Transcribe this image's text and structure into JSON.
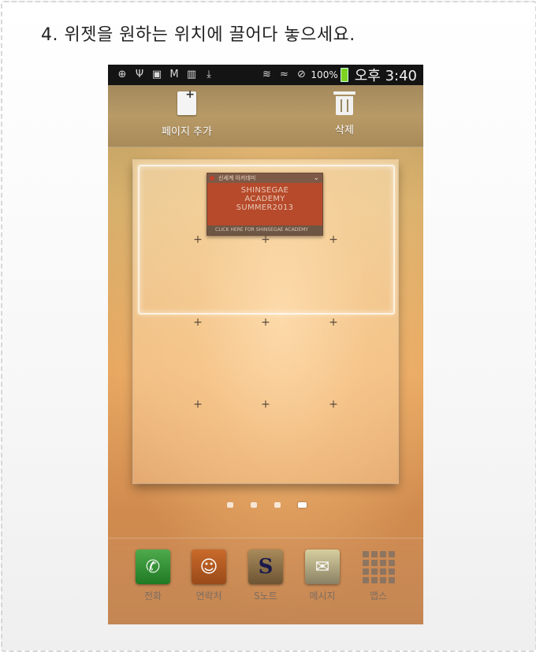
{
  "instruction": "4. 위젯을 원하는 위치에 끌어다 놓으세요.",
  "status_bar": {
    "battery_percent": "100%",
    "time": "오후 3:40"
  },
  "edit_bar": {
    "add_page_label": "페이지 추가",
    "delete_label": "삭제"
  },
  "widget": {
    "header_text": "신세계 아카데미",
    "lines": [
      "SHINSEGAE",
      "ACADEMY",
      "SUMMER2013"
    ],
    "footer_text": "CLICK HERE FOR SHINSEGAE ACADEMY"
  },
  "page_indicator": {
    "count": 4,
    "active_index": 3
  },
  "dock": {
    "apps": [
      {
        "label": "전화"
      },
      {
        "label": "연락처"
      },
      {
        "label": "S노트"
      },
      {
        "label": "메시지"
      },
      {
        "label": "앱스"
      }
    ]
  }
}
